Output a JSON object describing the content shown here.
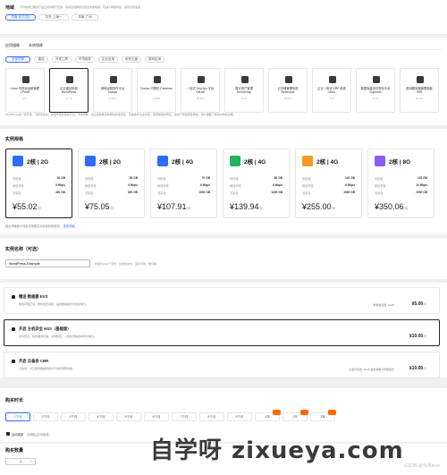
{
  "region": {
    "title": "地域",
    "hint": "不同地域云服务产品之间内网不互通，请就近选择靠近您业务的地域，可减少网络时延、提高访问速度",
    "options": [
      "华南-武汉(加)",
      "华东-上海一",
      "华南-广州"
    ]
  },
  "app_image": {
    "tabs": [
      "应用镜像",
      "系统镜像"
    ],
    "categories": [
      "全部镜像",
      "建站",
      "开发工具",
      "环境组件",
      "企业应用",
      "私有云盘",
      "游戏应用"
    ],
    "items": [
      {
        "name": "Linux 可视化运维管理 1Panel",
        "version": "2.1"
      },
      {
        "name": "企业建站系统 WordPress",
        "version": "6.7.1"
      },
      {
        "name": "网络远程协作平台 Jaaspe",
        "version": "4.13.2"
      },
      {
        "name": "Docker 可视化 Portainer",
        "version": "2.26.0"
      },
      {
        "name": "一站式 DevOps 平台 GitLab",
        "version": "16.8.1"
      },
      {
        "name": "数字资产管理 DemoShop",
        "version": "1.1.0"
      },
      {
        "name": "云存储管理系统 Nextcloud",
        "version": "29.0.1"
      },
      {
        "name": "企业一体化 ERP 系统 Odoo",
        "version": "17.0"
      },
      {
        "name": "数据库建设可视化平台 Superset",
        "version": "3.1.1"
      },
      {
        "name": "虚拟服务器管理面板 ISW",
        "version": "6.0.21"
      }
    ],
    "description": "WordPress是一款开源、可视化建站、主题丰富的建站平台，支持博客、企业官网等多种网站快速搭建，具备插件生态丰富、使用便捷的特点，适用于快速搭建网站，用户需要了解基本网站运维。"
  },
  "instance": {
    "title": "实例规格",
    "row_labels": [
      "系统盘",
      "峰值带宽",
      "流量包"
    ],
    "cards": [
      {
        "spec": "2核 | 2G",
        "disk": "40 GB",
        "bw": "3 Mbps",
        "traffic": "400 GB",
        "price": "¥55.02",
        "unit": "/月",
        "color": "#2f6bff"
      },
      {
        "spec": "2核 | 2G",
        "disk": "50 GB",
        "bw": "4 Mbps",
        "traffic": "800 GB",
        "price": "¥75.05",
        "unit": "/月",
        "color": "#2f6bff"
      },
      {
        "spec": "2核 | 4G",
        "disk": "70 GB",
        "bw": "6 Mbps",
        "traffic": "1000 GB",
        "price": "¥107.91",
        "unit": "/月",
        "color": "#2f6bff"
      },
      {
        "spec": "2核 | 4G",
        "disk": "80 GB",
        "bw": "6 Mbps",
        "traffic": "1200 GB",
        "price": "¥139.94",
        "unit": "/月",
        "color": "#22b35e"
      },
      {
        "spec": "2核 | 4G",
        "disk": "100 GB",
        "bw": "8 Mbps",
        "traffic": "1600 GB",
        "price": "¥255.00",
        "unit": "/月",
        "color": "#f59a23"
      },
      {
        "spec": "2核 | 8G",
        "disk": "120 GB",
        "bw": "10 Mbps",
        "traffic": "2000 GB",
        "price": "¥350.06",
        "unit": "/月",
        "color": "#8b5cf6"
      }
    ],
    "note": "超出规格部分流量将按照实际用量收取费用，",
    "note_link": "查看详细"
  },
  "name": {
    "title": "实例名称（可选）",
    "value": "WordPress-Example",
    "hint": "长度为2-64个字符，仅支持中文、英文字母、数字等"
  },
  "addons": [
    {
      "title": "赠送 数据盘 EVS",
      "desc": "赠送存储空间，限时免费领取，提供数据备份与恢复能力。",
      "meta": "数据盘容量  10GB",
      "price": "¥5.00",
      "unit": "/月"
    },
    {
      "title": "开启 主机安全 HSS（基础版）",
      "desc": "主机安全，提供漏洞扫描、基线检查、入侵检测等多种防护能力。",
      "meta": "",
      "price": "¥10.00",
      "unit": "/月"
    },
    {
      "title": "开启 云备份 CBR",
      "desc": "云备份，为云服务器提供备份与恢复保障功能。",
      "meta": "云备份容量  40GB   备份策略  5周期备份",
      "price": "¥10.00",
      "unit": "/月"
    }
  ],
  "duration": {
    "title": "购买时长",
    "options": [
      "1个月",
      "2个月",
      "3个月",
      "4个月",
      "5个月",
      "6个月",
      "7个月",
      "8个月",
      "9个月",
      "1年",
      "2年",
      "3年"
    ],
    "renew_label": "自动续费",
    "renew_hint": "（到期后自动续费）"
  },
  "quantity": {
    "title": "购买数量",
    "minus": "−",
    "value": "1",
    "plus": "+"
  },
  "watermark": "自学呀 zixueya.com",
  "credit": "CSDN @元月lcuo"
}
